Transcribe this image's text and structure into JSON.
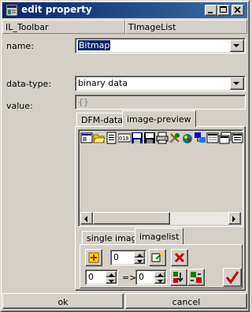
{
  "window": {
    "title": "edit property",
    "icon": "app-icon",
    "controls": [
      "minimize-icon",
      "maximize-icon",
      "close-icon"
    ]
  },
  "header": {
    "component": "IL_Toolbar",
    "component_type": "TImageList"
  },
  "fields": {
    "name_label": "name:",
    "name_value": "Bitmap",
    "datatype_label": "data-type:",
    "datatype_value": "binary data",
    "value_label": "value:",
    "value_value": "{}"
  },
  "tabs": {
    "items": [
      "DFM-data",
      "image-preview"
    ],
    "active": "image-preview"
  },
  "preview": {
    "image_count": 13
  },
  "subtabs": {
    "items": [
      "single image",
      "imagelist"
    ],
    "active": "imagelist"
  },
  "imagelist_controls": {
    "index_value": "0",
    "from_value": "0",
    "arrow_text": "=>",
    "to_value": "0"
  },
  "buttons": {
    "ok": "ok",
    "cancel": "cancel"
  },
  "colors": {
    "title_gradient_start": "#0a246a",
    "title_gradient_end": "#3a6ea5",
    "face": "#d4d0c8",
    "selection": "#0a246a",
    "delete_red": "#cc0000"
  }
}
